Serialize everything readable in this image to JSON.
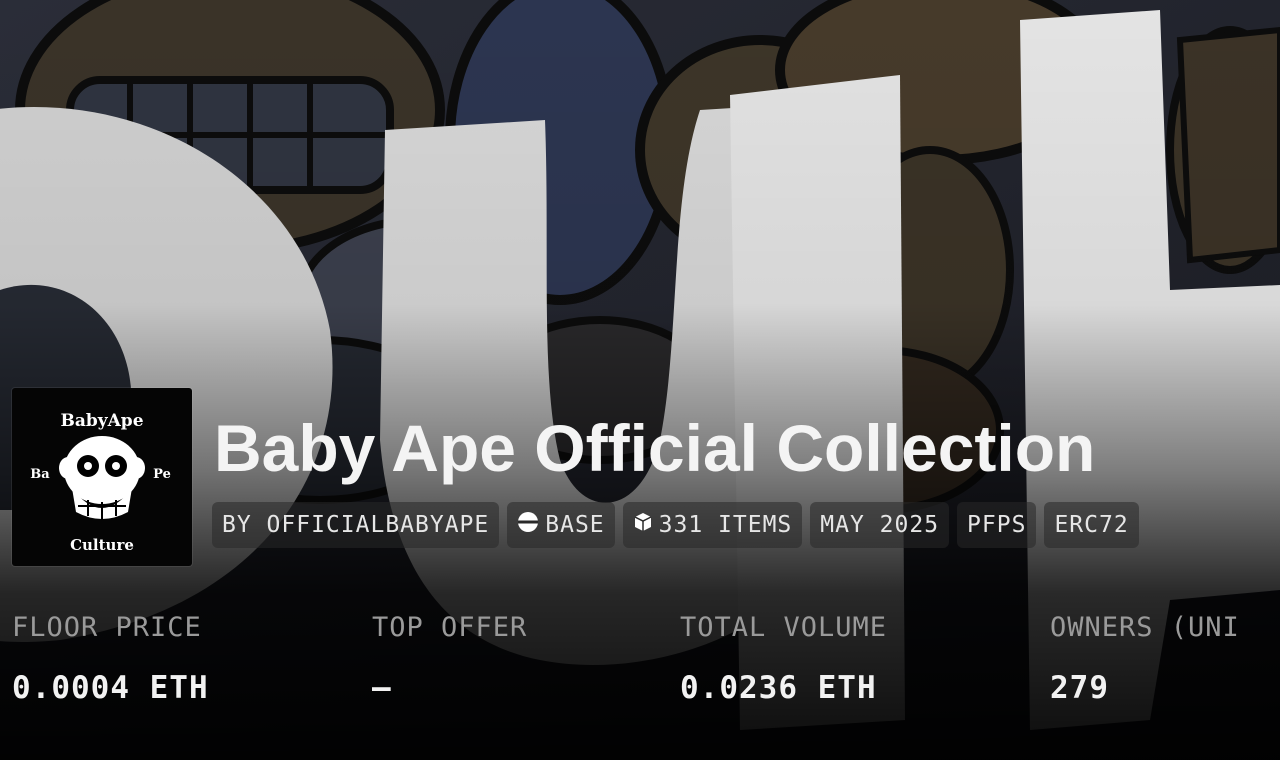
{
  "collection": {
    "title": "Baby Ape Official Collection",
    "logo": {
      "top_text": "BabyApe",
      "left_text": "Ba",
      "right_text": "Pe",
      "bottom_text": "Culture",
      "icon": "ape-skull-icon"
    }
  },
  "chips": [
    {
      "label": "BY OFFICIALBABYAPE",
      "icon": null
    },
    {
      "label": "BASE",
      "icon": "base-chain-icon"
    },
    {
      "label": "331 ITEMS",
      "icon": "cube-icon"
    },
    {
      "label": "MAY 2025",
      "icon": null
    },
    {
      "label": "PFPS",
      "icon": null
    },
    {
      "label": "ERC72",
      "icon": null
    }
  ],
  "stats": [
    {
      "label": "FLOOR PRICE",
      "value": "0.0004 ETH"
    },
    {
      "label": "TOP OFFER",
      "value": "—"
    },
    {
      "label": "TOTAL VOLUME",
      "value": "0.0236 ETH"
    },
    {
      "label": "OWNERS (UNI",
      "value": "279"
    }
  ],
  "colors": {
    "background": "#000000",
    "text_primary": "#f4f4f4",
    "text_muted": "#9a9a9a"
  }
}
